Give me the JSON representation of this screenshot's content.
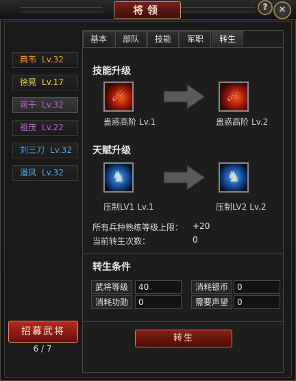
{
  "window": {
    "title": "将领",
    "help_label": "?",
    "close_label": "✕"
  },
  "tabs": [
    "基本",
    "部队",
    "技能",
    "军职",
    "转生"
  ],
  "active_tab": "转生",
  "generals": [
    {
      "name": "典韦",
      "level": "Lv.32",
      "color": "#f0a018"
    },
    {
      "name": "徐晃",
      "level": "Lv.17",
      "color": "#f0d040"
    },
    {
      "name": "蒋干",
      "level": "Lv.32",
      "color": "#c060d8"
    },
    {
      "name": "祖茂",
      "level": "Lv.22",
      "color": "#c060d8"
    },
    {
      "name": "刘三刀",
      "level": "Lv.32",
      "color": "#5aa8e8"
    },
    {
      "name": "潘凤",
      "level": "Lv.32",
      "color": "#5aa8e8"
    }
  ],
  "selected_general_index": 2,
  "recruit": {
    "button_label": "招募武将",
    "count": "6 / 7"
  },
  "skill_upgrade": {
    "title": "技能升级",
    "from": {
      "name": "蛊惑高阶",
      "level": "Lv.1",
      "icon": "fire-orb-icon"
    },
    "to": {
      "name": "蛊惑高阶",
      "level": "Lv.2",
      "icon": "fire-orb-icon"
    }
  },
  "talent_upgrade": {
    "title": "天赋升级",
    "from": {
      "name": "压制LV1",
      "level": "Lv.1",
      "icon": "blue-figure-icon"
    },
    "to": {
      "name": "压制LV2",
      "level": "Lv.2",
      "icon": "blue-figure-icon"
    }
  },
  "stats": [
    {
      "label": "所有兵种熟练等级上限：",
      "value": "+20"
    },
    {
      "label": "当前转生次数：",
      "value": "0"
    }
  ],
  "conditions": {
    "title": "转生条件",
    "items": [
      {
        "label": "武将等级",
        "value": "40"
      },
      {
        "label": "消耗银币",
        "value": "0"
      },
      {
        "label": "消耗功勋",
        "value": "0"
      },
      {
        "label": "需要声望",
        "value": "0"
      }
    ]
  },
  "rebirth_button_label": "转生"
}
